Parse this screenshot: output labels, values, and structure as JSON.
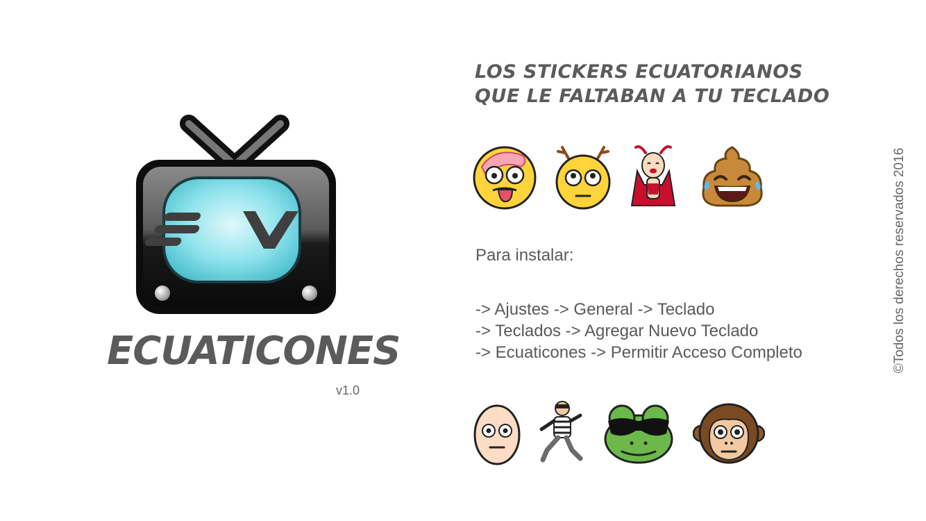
{
  "brand": {
    "name": "ECUATICONES",
    "version": "v1.0",
    "logo_icon": "tv-icon",
    "logo_text": "EV",
    "accent_color": "#7fdde8"
  },
  "headline": {
    "line1": "LOS STICKERS ECUATORIANOS",
    "line2": "QUE LE FALTABAN A TU TECLADO"
  },
  "stickers_top": [
    "flushed-tongue-sticker-icon",
    "reindeer-sticker-icon",
    "devil-girl-sticker-icon",
    "laughing-poop-sticker-icon"
  ],
  "install": {
    "title": "Para instalar:",
    "steps": [
      "-> Ajustes -> General -> Teclado",
      "-> Teclados -> Agregar Nuevo Teclado",
      "-> Ecuaticones -> Permitir Acceso Completo"
    ]
  },
  "stickers_bottom": [
    "egg-face-sticker-icon",
    "thief-running-sticker-icon",
    "frog-sunglasses-sticker-icon",
    "monkey-sticker-icon"
  ],
  "copyright": "©Todos los derechos reservados 2016"
}
